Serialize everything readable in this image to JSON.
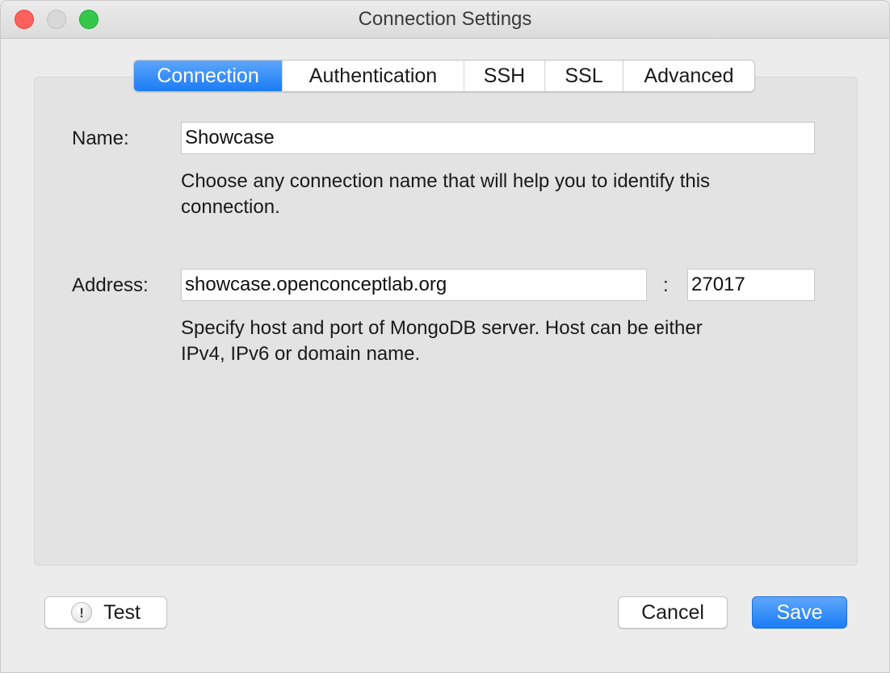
{
  "window": {
    "title": "Connection Settings"
  },
  "tabs": [
    {
      "label": "Connection",
      "active": true
    },
    {
      "label": "Authentication",
      "active": false
    },
    {
      "label": "SSH",
      "active": false
    },
    {
      "label": "SSL",
      "active": false
    },
    {
      "label": "Advanced",
      "active": false
    }
  ],
  "form": {
    "name_label": "Name:",
    "name_value": "Showcase",
    "name_help_line1": "Choose any connection name that will help you to identify this",
    "name_help_line2": "connection.",
    "address_label": "Address:",
    "host_value": "showcase.openconceptlab.org",
    "separator": ":",
    "port_value": "27017",
    "address_help_line1": "Specify host and port of MongoDB server. Host can be either",
    "address_help_line2": "IPv4, IPv6 or domain name."
  },
  "buttons": {
    "test_icon": "!",
    "test_label": "Test",
    "cancel_label": "Cancel",
    "save_label": "Save"
  },
  "colors": {
    "accent": "#1a7cf5",
    "close": "#fc615d",
    "minimize": "#d8d8d8",
    "zoom": "#34c84a"
  }
}
